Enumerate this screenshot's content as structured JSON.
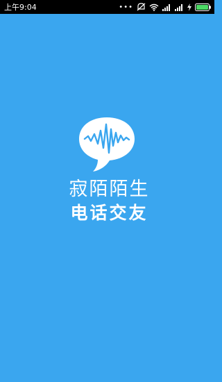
{
  "status_bar": {
    "time": "上午9:04",
    "icons": [
      "more-dots-icon",
      "mute-icon",
      "wifi-icon",
      "signal-icon",
      "signal-icon",
      "charging-icon",
      "battery-icon"
    ],
    "battery_level": 1.0
  },
  "splash": {
    "title": "寂陌陌生",
    "subtitle": "电话交友",
    "logo_icon": "speech-bubble-waveform-icon"
  },
  "colors": {
    "background": "#3aa6ef",
    "status_bar": "#000000",
    "text": "#ffffff",
    "battery": "#4cd964"
  }
}
